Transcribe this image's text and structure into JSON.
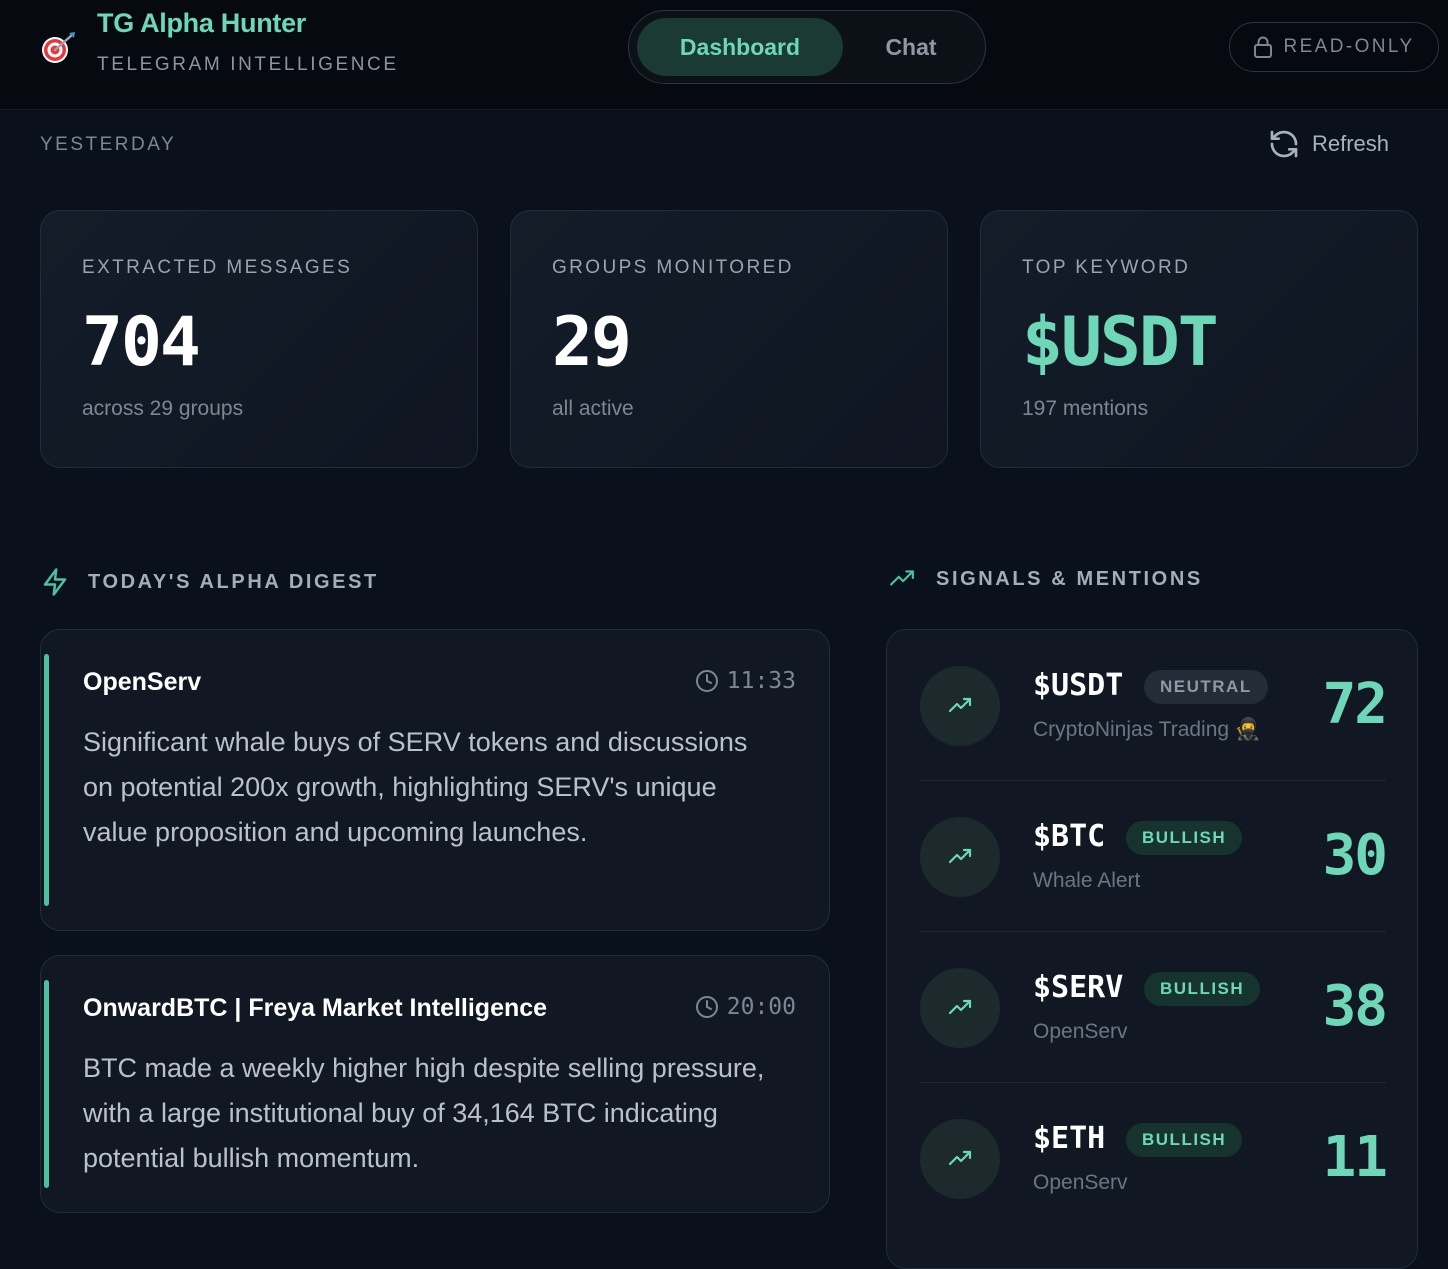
{
  "header": {
    "app_name": "TG Alpha Hunter",
    "app_subtitle": "TELEGRAM INTELLIGENCE",
    "logo_icon": "target-dart-icon",
    "tabs": [
      {
        "label": "Dashboard",
        "active": true
      },
      {
        "label": "Chat",
        "active": false
      }
    ],
    "mode_label": "READ-ONLY",
    "mode_icon": "lock-icon"
  },
  "toolbar": {
    "date_label": "YESTERDAY",
    "refresh_label": "Refresh",
    "refresh_icon": "refresh-icon"
  },
  "stats": [
    {
      "label": "EXTRACTED MESSAGES",
      "value": "704",
      "sub": "across 29 groups"
    },
    {
      "label": "GROUPS MONITORED",
      "value": "29",
      "sub": "all active"
    },
    {
      "label": "TOP KEYWORD",
      "value": "$USDT",
      "sub": "197 mentions"
    }
  ],
  "digest": {
    "heading": "TODAY'S ALPHA DIGEST",
    "icon": "lightning-icon",
    "items": [
      {
        "source": "OpenServ",
        "time": "11:33",
        "summary": "Significant whale buys of SERV tokens and discussions on potential 200x growth, highlighting SERV's unique value proposition and upcoming launches."
      },
      {
        "source": "OnwardBTC | Freya Market Intelligence",
        "time": "20:00",
        "summary": "BTC made a weekly higher high despite selling pressure, with a large institutional buy of 34,164 BTC indicating potential bullish momentum."
      }
    ]
  },
  "signals": {
    "heading": "SIGNALS & MENTIONS",
    "icon": "trending-up-icon",
    "items": [
      {
        "ticker": "$USDT",
        "sentiment": "NEUTRAL",
        "source": "CryptoNinjas Trading 🥷",
        "count": "72"
      },
      {
        "ticker": "$BTC",
        "sentiment": "BULLISH",
        "source": "Whale Alert",
        "count": "30"
      },
      {
        "ticker": "$SERV",
        "sentiment": "BULLISH",
        "source": "OpenServ",
        "count": "38"
      },
      {
        "ticker": "$ETH",
        "sentiment": "BULLISH",
        "source": "OpenServ",
        "count": "11"
      }
    ]
  },
  "colors": {
    "accent": "#6fd6b8",
    "background": "#0b111c",
    "card": "#111824",
    "bullish_badge": "#16342d",
    "neutral_badge": "#242c37"
  }
}
